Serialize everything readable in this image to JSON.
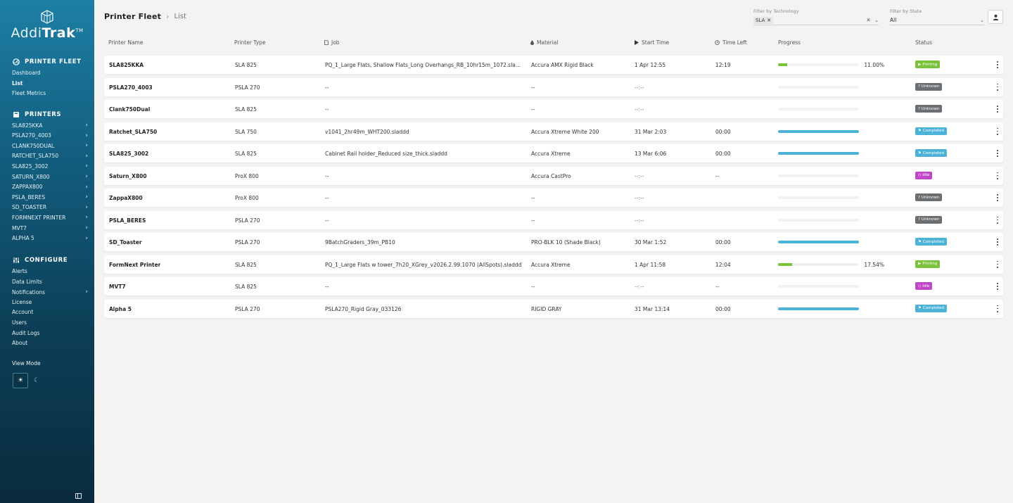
{
  "app": {
    "brand": {
      "name_light": "Addi",
      "name_bold": "Trak",
      "tm": "TM"
    }
  },
  "header": {
    "title": "Printer Fleet",
    "separator": "›",
    "page": "List"
  },
  "filters": {
    "technology": {
      "label": "Filter by Technology",
      "chip": "SLA"
    },
    "state": {
      "label": "Filter by State",
      "value": "All"
    }
  },
  "sidebar": {
    "fleet_section": "PRINTER FLEET",
    "fleet_items": [
      {
        "label": "Dashboard",
        "active": false
      },
      {
        "label": "List",
        "active": true
      },
      {
        "label": "Fleet Metrics",
        "active": false
      }
    ],
    "printers_section": "PRINTERS",
    "printer_items": [
      "SLA825KKA",
      "PSLA270_4003",
      "CLANK750DUAL",
      "RATCHET_SLA750",
      "SLA825_3002",
      "SATURN_X800",
      "ZAPPAX800",
      "PSLA_BERES",
      "SD_TOASTER",
      "FORMNEXT PRINTER",
      "MVT7",
      "ALPHA 5"
    ],
    "configure_section": "CONFIGURE",
    "configure_items": [
      {
        "label": "Alerts",
        "chevron": false
      },
      {
        "label": "Data Limits",
        "chevron": false
      },
      {
        "label": "Notifications",
        "chevron": true
      },
      {
        "label": "License",
        "chevron": false
      },
      {
        "label": "Account",
        "chevron": false
      },
      {
        "label": "Users",
        "chevron": false
      },
      {
        "label": "Audit Logs",
        "chevron": false
      },
      {
        "label": "About",
        "chevron": false
      }
    ],
    "view_mode_label": "View Mode"
  },
  "table": {
    "columns": {
      "name": "Printer Name",
      "type": "Printer Type",
      "job": "Job",
      "material": "Material",
      "start": "Start Time",
      "left": "Time Left",
      "progress": "Progress",
      "status": "Status"
    },
    "rows": [
      {
        "name": "SLA825KKA",
        "type": "SLA 825",
        "job": "PQ_1_Large Flats, Shallow Flats_Long Overhangs_RB_10hr15m_1072.sla...",
        "material": "Accura AMX Rigid Black",
        "start": "1 Apr 12:55",
        "left": "12:19",
        "progress": 0.11,
        "pct": "11.00%",
        "status": "Printing"
      },
      {
        "name": "PSLA270_4003",
        "type": "PSLA 270",
        "job": "--",
        "material": "--",
        "start": "--:--",
        "left": "",
        "progress": 0,
        "pct": "",
        "status": "Unknown"
      },
      {
        "name": "Clank750Dual",
        "type": "SLA 825",
        "job": "--",
        "material": "--",
        "start": "--:--",
        "left": "",
        "progress": 0,
        "pct": "",
        "status": "Unknown"
      },
      {
        "name": "Ratchet_SLA750",
        "type": "SLA 750",
        "job": "v1041_2hr49m_WHT200.sladdd",
        "material": "Accura Xtreme White 200",
        "start": "31 Mar 2:03",
        "left": "00:00",
        "progress": 1,
        "pct": "",
        "status": "Completed"
      },
      {
        "name": "SLA825_3002",
        "type": "SLA 825",
        "job": "Cabinet Rail holder_Reduced size_thick.sladdd",
        "material": "Accura Xtreme",
        "start": "13 Mar 6:06",
        "left": "00:00",
        "progress": 1,
        "pct": "",
        "status": "Completed"
      },
      {
        "name": "Saturn_X800",
        "type": "ProX 800",
        "job": "--",
        "material": "Accura CastPro",
        "start": "--:--",
        "left": "--",
        "progress": 0,
        "pct": "",
        "status": "Idle"
      },
      {
        "name": "ZappaX800",
        "type": "ProX 800",
        "job": "--",
        "material": "--",
        "start": "--:--",
        "left": "",
        "progress": 0,
        "pct": "",
        "status": "Unknown"
      },
      {
        "name": "PSLA_BERES",
        "type": "PSLA 270",
        "job": "--",
        "material": "--",
        "start": "--:--",
        "left": "",
        "progress": 0,
        "pct": "",
        "status": "Unknown"
      },
      {
        "name": "SD_Toaster",
        "type": "PSLA 270",
        "job": "9BatchGraders_39m_PB10",
        "material": "PRO-BLK 10 (Shade Black)",
        "start": "30 Mar 1:52",
        "left": "00:00",
        "progress": 1,
        "pct": "",
        "status": "Completed"
      },
      {
        "name": "FormNext Printer",
        "type": "SLA 825",
        "job": "PQ_1_Large Flats w tower_7h20_XGrey_v2026.2.99.1070 (AllSpots).sladdd",
        "material": "Accura Xtreme",
        "start": "1 Apr 11:58",
        "left": "12:04",
        "progress": 0.1754,
        "pct": "17.54%",
        "status": "Printing"
      },
      {
        "name": "MVT7",
        "type": "SLA 825",
        "job": "--",
        "material": "--",
        "start": "--:--",
        "left": "--",
        "progress": 0,
        "pct": "",
        "status": "Idle"
      },
      {
        "name": "Alpha 5",
        "type": "PSLA 270",
        "job": "PSLA270_Rigid Gray_033126",
        "material": "RIGID GRAY",
        "start": "31 Mar 13:14",
        "left": "00:00",
        "progress": 1,
        "pct": "",
        "status": "Completed"
      }
    ]
  },
  "colors": {
    "Printing": "#7ac23a",
    "Unknown": "#6b6f72",
    "Completed": "#4bb3d8",
    "Idle": "#c046c9",
    "progress_active": "#7ac23a",
    "progress_done": "#4bb3d8"
  },
  "status_icons": {
    "Printing": "play-icon",
    "Unknown": "question-circle-icon",
    "Completed": "flag-icon",
    "Idle": "pause-circle-icon"
  }
}
